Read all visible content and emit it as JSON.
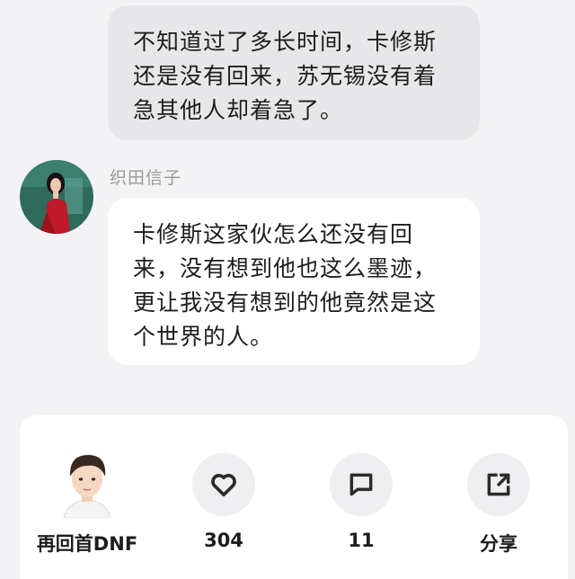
{
  "previous_message": {
    "lines": [
      "不知道过了多长时间，卡修斯",
      "还是没有回来，苏无锡没有着",
      "急其他人却着急了。"
    ]
  },
  "message": {
    "speaker": "织田信子",
    "lines": [
      "卡修斯这家伙怎么还没有回",
      "来，没有想到他也这么墨迹，",
      "更让我没有想到的他竟然是这",
      "个世界的人。"
    ]
  },
  "bottom_bar": {
    "author": "再回首DNF",
    "likes": "304",
    "comments": "11",
    "share": "分享"
  },
  "colors": {
    "background": "#f3f3f5",
    "gray_bubble": "#e7e7ea",
    "white_bubble": "#ffffff",
    "icon_circle": "#efeff2",
    "icon_stroke": "#2b2b2b",
    "avatar_dress": "#c0192a",
    "avatar_bg": "#2f6a5a"
  },
  "icons": [
    "heart-icon",
    "comment-icon",
    "share-icon"
  ]
}
